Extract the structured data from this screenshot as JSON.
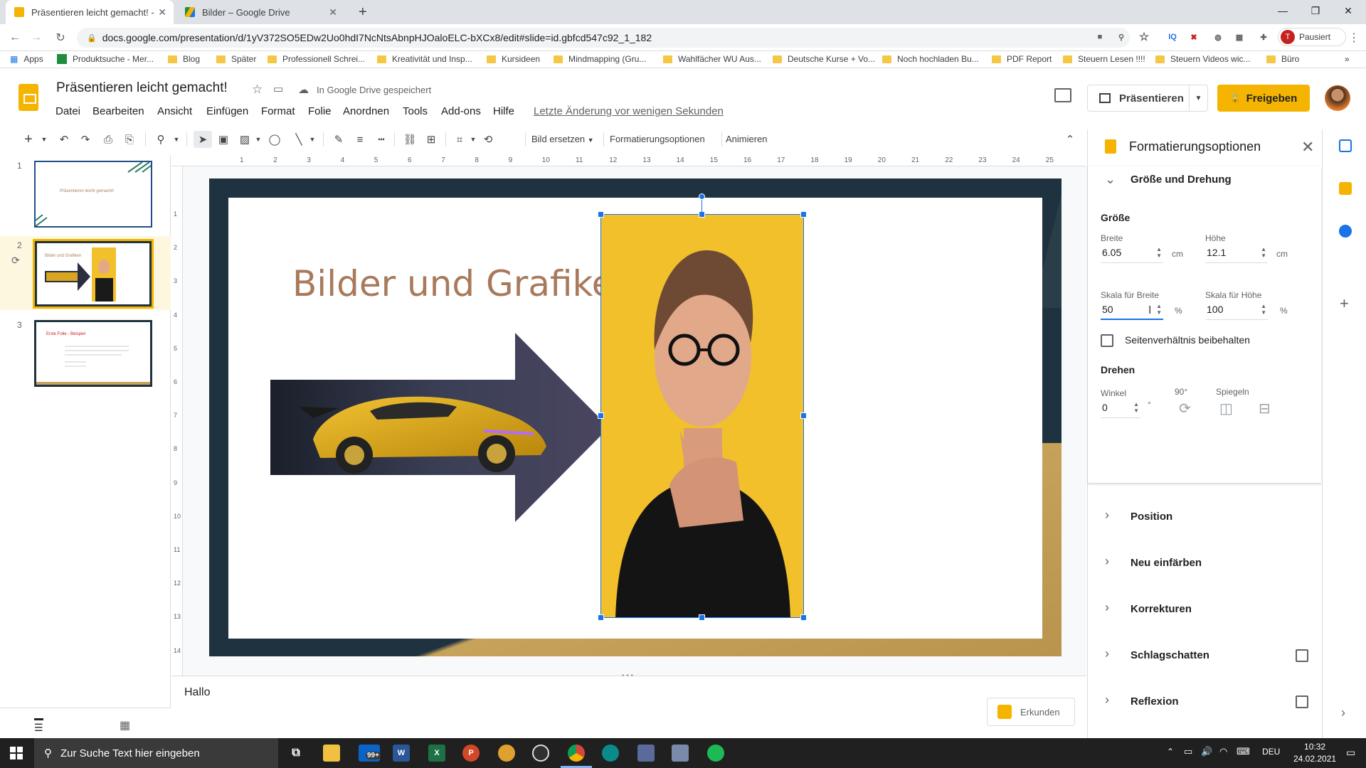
{
  "browser": {
    "tabs": [
      {
        "title": "Präsentieren leicht gemacht! - Gc",
        "active": true
      },
      {
        "title": "Bilder – Google Drive",
        "active": false
      }
    ],
    "url": "docs.google.com/presentation/d/1yV372SO5EDw2Uo0hdI7NcNtsAbnpHJOaloELC-bXCx8/edit#slide=id.gbfcd547c92_1_182",
    "profile_label": "Pausiert",
    "profile_initial": "T",
    "bookmarks": [
      "Apps",
      "Produktsuche - Mer...",
      "Blog",
      "Später",
      "Professionell Schrei...",
      "Kreativität und Insp...",
      "Kursideen",
      "Mindmapping (Gru...",
      "Wahlfächer WU Aus...",
      "Deutsche Kurse + Vo...",
      "Noch hochladen Bu...",
      "PDF Report",
      "Steuern Lesen !!!!",
      "Steuern Videos wic...",
      "Büro"
    ]
  },
  "app": {
    "doc_title": "Präsentieren leicht gemacht!",
    "saved_state": "In Google Drive gespeichert",
    "menus": [
      "Datei",
      "Bearbeiten",
      "Ansicht",
      "Einfügen",
      "Format",
      "Folie",
      "Anordnen",
      "Tools",
      "Add-ons",
      "Hilfe"
    ],
    "last_edit": "Letzte Änderung vor wenigen Sekunden",
    "present_label": "Präsentieren",
    "share_label": "Freigeben"
  },
  "toolbar": {
    "replace_image": "Bild ersetzen",
    "format_options": "Formatierungsoptionen",
    "animate": "Animieren"
  },
  "ruler": {
    "top_ticks": [
      "1",
      "2",
      "3",
      "4",
      "5",
      "6",
      "7",
      "8",
      "9",
      "10",
      "11",
      "12",
      "13",
      "14",
      "15",
      "16",
      "17",
      "18",
      "19",
      "20",
      "21",
      "22",
      "23",
      "24",
      "25"
    ],
    "left_ticks": [
      "1",
      "2",
      "3",
      "4",
      "5",
      "6",
      "7",
      "8",
      "9",
      "10",
      "11",
      "12",
      "13",
      "14"
    ]
  },
  "filmstrip": {
    "slides": [
      {
        "num": "1",
        "title": "Präsentieren leicht gemacht!"
      },
      {
        "num": "2",
        "title": "Bilder und Grafiken"
      },
      {
        "num": "3",
        "title": "Erste Folie - Beispiel"
      }
    ]
  },
  "slide": {
    "title": "Bilder und Grafiken"
  },
  "notes": {
    "text": "Hallo",
    "explore_label": "Erkunden"
  },
  "format_panel": {
    "title": "Formatierungsoptionen",
    "size_rotation": {
      "header": "Größe und Drehung",
      "size_label": "Größe",
      "width_label": "Breite",
      "width_value": "6.05",
      "height_label": "Höhe",
      "height_value": "12.1",
      "unit_cm": "cm",
      "scale_width_label": "Skala für Breite",
      "scale_width_value": "50",
      "scale_height_label": "Skala für Höhe",
      "scale_height_value": "100",
      "unit_pct": "%",
      "keep_ratio_label": "Seitenverhältnis beibehalten",
      "keep_ratio_checked": false,
      "rotate_label": "Drehen",
      "angle_label": "Winkel",
      "angle_value": "0",
      "angle_unit": "°",
      "rotate90_label": "90°",
      "mirror_label": "Spiegeln"
    },
    "sections": [
      {
        "label": "Position",
        "checkbox": false
      },
      {
        "label": "Neu einfärben",
        "checkbox": false
      },
      {
        "label": "Korrekturen",
        "checkbox": false
      },
      {
        "label": "Schlagschatten",
        "checkbox": true
      },
      {
        "label": "Reflexion",
        "checkbox": true
      }
    ]
  },
  "taskbar": {
    "search_placeholder": "Zur Suche Text hier eingeben",
    "mail_badge": "99+",
    "language": "DEU",
    "time": "10:32",
    "date": "24.02.2021"
  },
  "colors": {
    "accent_yellow": "#f4b400",
    "selection_blue": "#1a73e8",
    "title_brown": "#a87a5b",
    "slide_dark": "#1e3240",
    "slide_gold": "#c7a25a"
  }
}
